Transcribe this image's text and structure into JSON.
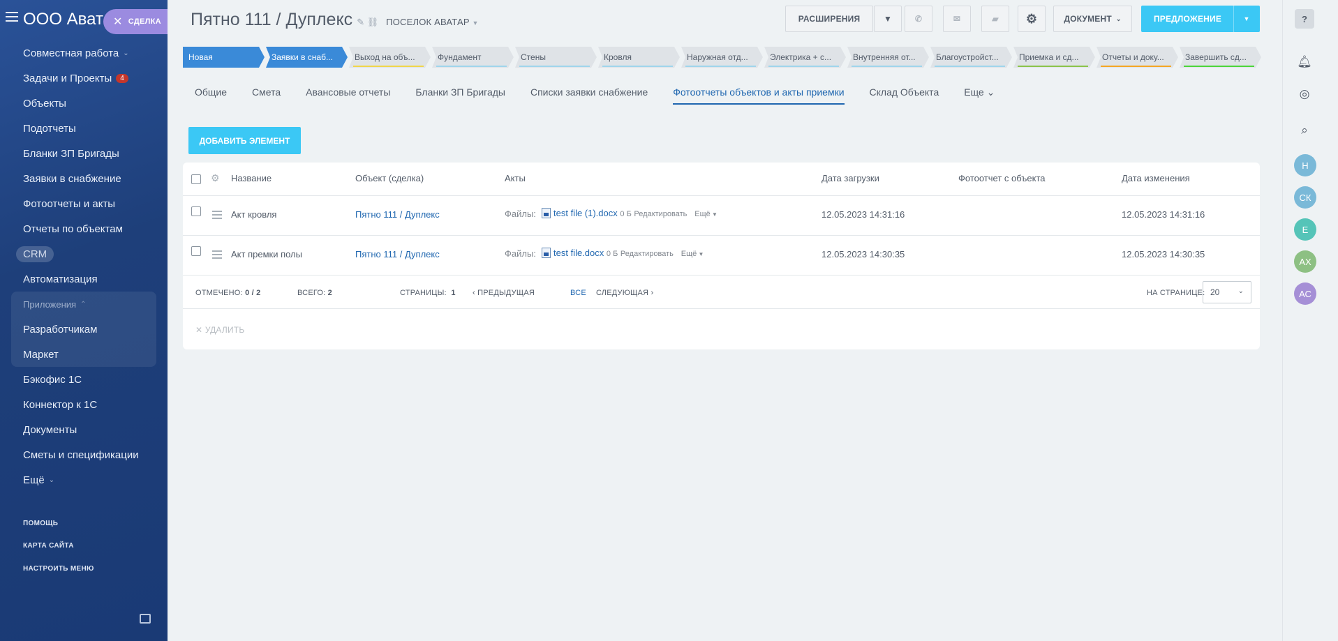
{
  "sidebar": {
    "org_name": "ООО Аватар",
    "deal_chip": "СДЕЛКА",
    "items": [
      {
        "label": "Совместная работа",
        "arrow": "⌄"
      },
      {
        "label": "Задачи и Проекты",
        "badge": "4"
      },
      {
        "label": "Объекты"
      },
      {
        "label": "Подотчеты"
      },
      {
        "label": "Бланки ЗП Бригады"
      },
      {
        "label": "Заявки в снабжение"
      },
      {
        "label": "Фотоотчеты и акты"
      },
      {
        "label": "Отчеты по объектам"
      },
      {
        "label": "CRM"
      },
      {
        "label": "Автоматизация"
      }
    ],
    "apps_group": {
      "label": "Приложения",
      "children": [
        "Разработчикам",
        "Маркет"
      ]
    },
    "items2": [
      "Бэкофис 1С",
      "Коннектор к 1С",
      "Документы",
      "Сметы и спецификации",
      "Ещё"
    ],
    "footer": [
      "ПОМОЩЬ",
      "КАРТА САЙТА",
      "НАСТРОИТЬ МЕНЮ"
    ]
  },
  "header": {
    "title": "Пятно 111 / Дуплекс",
    "category": "ПОСЕЛОК АВАТАР",
    "extensions": "РАСШИРЕНИЯ",
    "document": "ДОКУМЕНТ",
    "proposal": "ПРЕДЛОЖЕНИЕ"
  },
  "stages": [
    {
      "label": "Новая",
      "color": "#3a8ad8",
      "active": true
    },
    {
      "label": "Заявки в снаб...",
      "color": "#3a8ad8",
      "active": true
    },
    {
      "label": "Выход на объ...",
      "color": "#f0d64a"
    },
    {
      "label": "Фундамент",
      "color": "#9fd5ec"
    },
    {
      "label": "Стены",
      "color": "#9fd5ec"
    },
    {
      "label": "Кровля",
      "color": "#9fd5ec"
    },
    {
      "label": "Наружная отд...",
      "color": "#9fd5ec"
    },
    {
      "label": "Электрика + с...",
      "color": "#9fd5ec"
    },
    {
      "label": "Внутренняя от...",
      "color": "#9fd5ec"
    },
    {
      "label": "Благоустройст...",
      "color": "#9fd5ec"
    },
    {
      "label": "Приемка и сд...",
      "color": "#8bc34a"
    },
    {
      "label": "Отчеты и доку...",
      "color": "#f5a623"
    },
    {
      "label": "Завершить сд...",
      "color": "#4cd53a"
    }
  ],
  "tabs": [
    "Общие",
    "Смета",
    "Авансовые отчеты",
    "Бланки ЗП Бригады",
    "Списки заявки снабжение",
    "Фотоотчеты объектов и акты приемки",
    "Склад Объекта",
    "Еще"
  ],
  "active_tab": 5,
  "add_button": "ДОБАВИТЬ ЭЛЕМЕНТ",
  "grid": {
    "columns": [
      "Название",
      "Объект (сделка)",
      "Акты",
      "Дата загрузки",
      "Фотоотчет с объекта",
      "Дата изменения"
    ],
    "rows": [
      {
        "name": "Акт кровля",
        "object": "Пятно 111 / Дуплекс",
        "files_label": "Файлы:",
        "file": "test file (1).docx",
        "size": "0 Б",
        "edit": "Редактировать",
        "more": "Ещё",
        "uploaded": "12.05.2023 14:31:16",
        "photo": "",
        "modified": "12.05.2023 14:31:16"
      },
      {
        "name": "Акт премки полы",
        "object": "Пятно 111 / Дуплекс",
        "files_label": "Файлы:",
        "file": "test file.docx",
        "size": "0 Б",
        "edit": "Редактировать",
        "more": "Ещё",
        "uploaded": "12.05.2023 14:30:35",
        "photo": "",
        "modified": "12.05.2023 14:30:35"
      }
    ],
    "footer": {
      "selected_label": "ОТМЕЧЕНО:",
      "selected_value": "0 / 2",
      "total_label": "ВСЕГО:",
      "total_value": "2",
      "pages_label": "СТРАНИЦЫ:",
      "pages_value": "1",
      "prev": "ПРЕДЫДУЩАЯ",
      "all": "ВСЕ",
      "next": "СЛЕДУЮЩАЯ",
      "per_page_label": "НА СТРАНИЦЕ:",
      "per_page_value": "20"
    },
    "delete_label": "УДАЛИТЬ"
  },
  "right_bar": {
    "help": "?",
    "avatars": [
      {
        "initials": "Н",
        "color": "#7ab9d8"
      },
      {
        "initials": "СК",
        "color": "#7ab9d8"
      },
      {
        "initials": "Е",
        "color": "#55c4b8"
      },
      {
        "initials": "АХ",
        "color": "#8dc083"
      },
      {
        "initials": "АС",
        "color": "#a58fd6"
      }
    ]
  }
}
